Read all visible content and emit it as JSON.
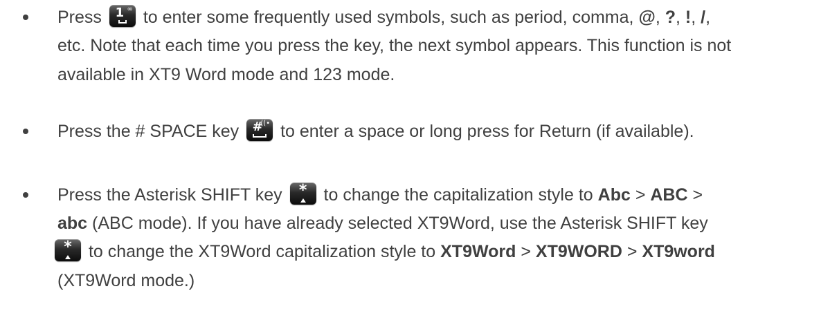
{
  "bullets": [
    {
      "lines": [
        {
          "p1": "Press",
          "p2": "to enter some frequently used symbols, such as period, comma,",
          "s1": "@",
          "s2": "?",
          "s3": "!",
          "s4": "/"
        },
        {
          "text": "etc. Note that each time you press the key, the next symbol appears. This function is not"
        },
        {
          "text": "available in XT9 Word mode and 123 mode."
        }
      ],
      "key": {
        "icon": "one-symbol-key-icon",
        "glyph": "1",
        "sub": "∞"
      }
    },
    {
      "lines": [
        {
          "p1": "Press the # SPACE key",
          "p2": "to enter a space or long press for Return (if available)."
        }
      ],
      "key": {
        "icon": "pound-space-key-icon",
        "glyph": "#",
        "sub": "((•"
      }
    },
    {
      "lines": [
        {
          "p1": "Press the Asterisk SHIFT key",
          "p2": "to change the capitalization style to",
          "b1": "Abc",
          "b2": "ABC"
        },
        {
          "b3": "abc",
          "p3": "(ABC mode). If you have already selected XT9Word, use the Asterisk SHIFT key"
        },
        {
          "p4": "to change the XT9Word capitalization style to",
          "b4": "XT9Word",
          "b5": "XT9WORD",
          "b6": "XT9word"
        },
        {
          "text": "(XT9Word mode.)"
        }
      ],
      "key": {
        "icon": "asterisk-shift-key-icon",
        "glyph": "*"
      }
    }
  ],
  "separators": {
    "comma": ",",
    "comma_space": ", ",
    "gt": " > "
  }
}
